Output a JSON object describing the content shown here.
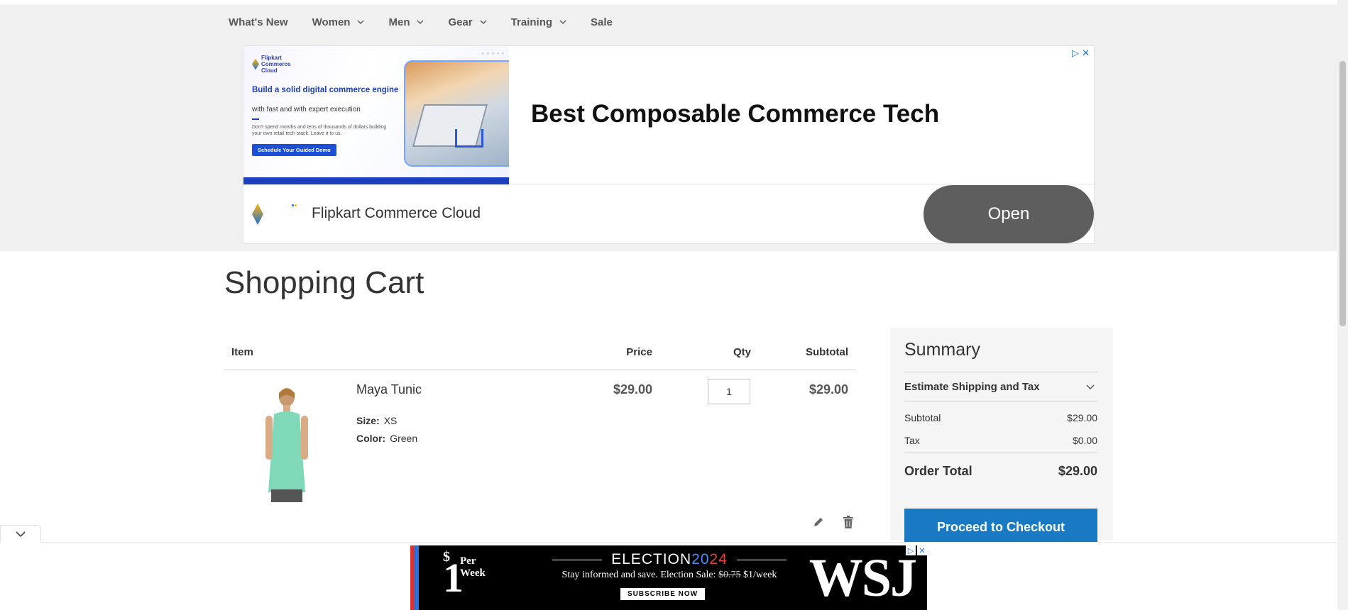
{
  "nav": {
    "items": [
      {
        "label": "What's New",
        "has_menu": false
      },
      {
        "label": "Women",
        "has_menu": true
      },
      {
        "label": "Men",
        "has_menu": true
      },
      {
        "label": "Gear",
        "has_menu": true
      },
      {
        "label": "Training",
        "has_menu": true
      },
      {
        "label": "Sale",
        "has_menu": false
      }
    ]
  },
  "ad": {
    "logo_text": "Flipkart Commerce Cloud",
    "headline": "Build a solid digital commerce engine",
    "subline": "with fast and with expert execution",
    "body": "Don't spend months and tens of thousands of dollars building your own retail tech stack. Leave it to us.",
    "cta": "Schedule Your Guided Demo",
    "title": "Best Composable Commerce Tech",
    "brand": "Flipkart Commerce Cloud",
    "open_label": "Open",
    "choices_icon": "ad-choices-icon",
    "close_icon": "close-icon"
  },
  "page": {
    "title": "Shopping Cart"
  },
  "cart": {
    "headers": {
      "item": "Item",
      "price": "Price",
      "qty": "Qty",
      "subtotal": "Subtotal"
    },
    "items": [
      {
        "name": "Maya Tunic",
        "size_label": "Size:",
        "size": "XS",
        "color_label": "Color:",
        "color": "Green",
        "price": "$29.00",
        "qty": "1",
        "subtotal": "$29.00",
        "image_color": "#7fd8b8"
      }
    ]
  },
  "summary": {
    "title": "Summary",
    "estimate_label": "Estimate Shipping and Tax",
    "subtotal_label": "Subtotal",
    "subtotal_value": "$29.00",
    "tax_label": "Tax",
    "tax_value": "$0.00",
    "order_total_label": "Order Total",
    "order_total_value": "$29.00",
    "checkout_label": "Proceed to Checkout",
    "accent": "#1979c3"
  },
  "anchor_ad": {
    "price": "1",
    "price_symbol": "$",
    "per_week": "Per Week",
    "election": "ELECTION2024",
    "tagline_prefix": "Stay informed and save. Election Sale:",
    "old_price": "$0.75",
    "new_price": "$1/week",
    "subscribe": "SUBSCRIBE NOW",
    "logo": "WSJ"
  }
}
